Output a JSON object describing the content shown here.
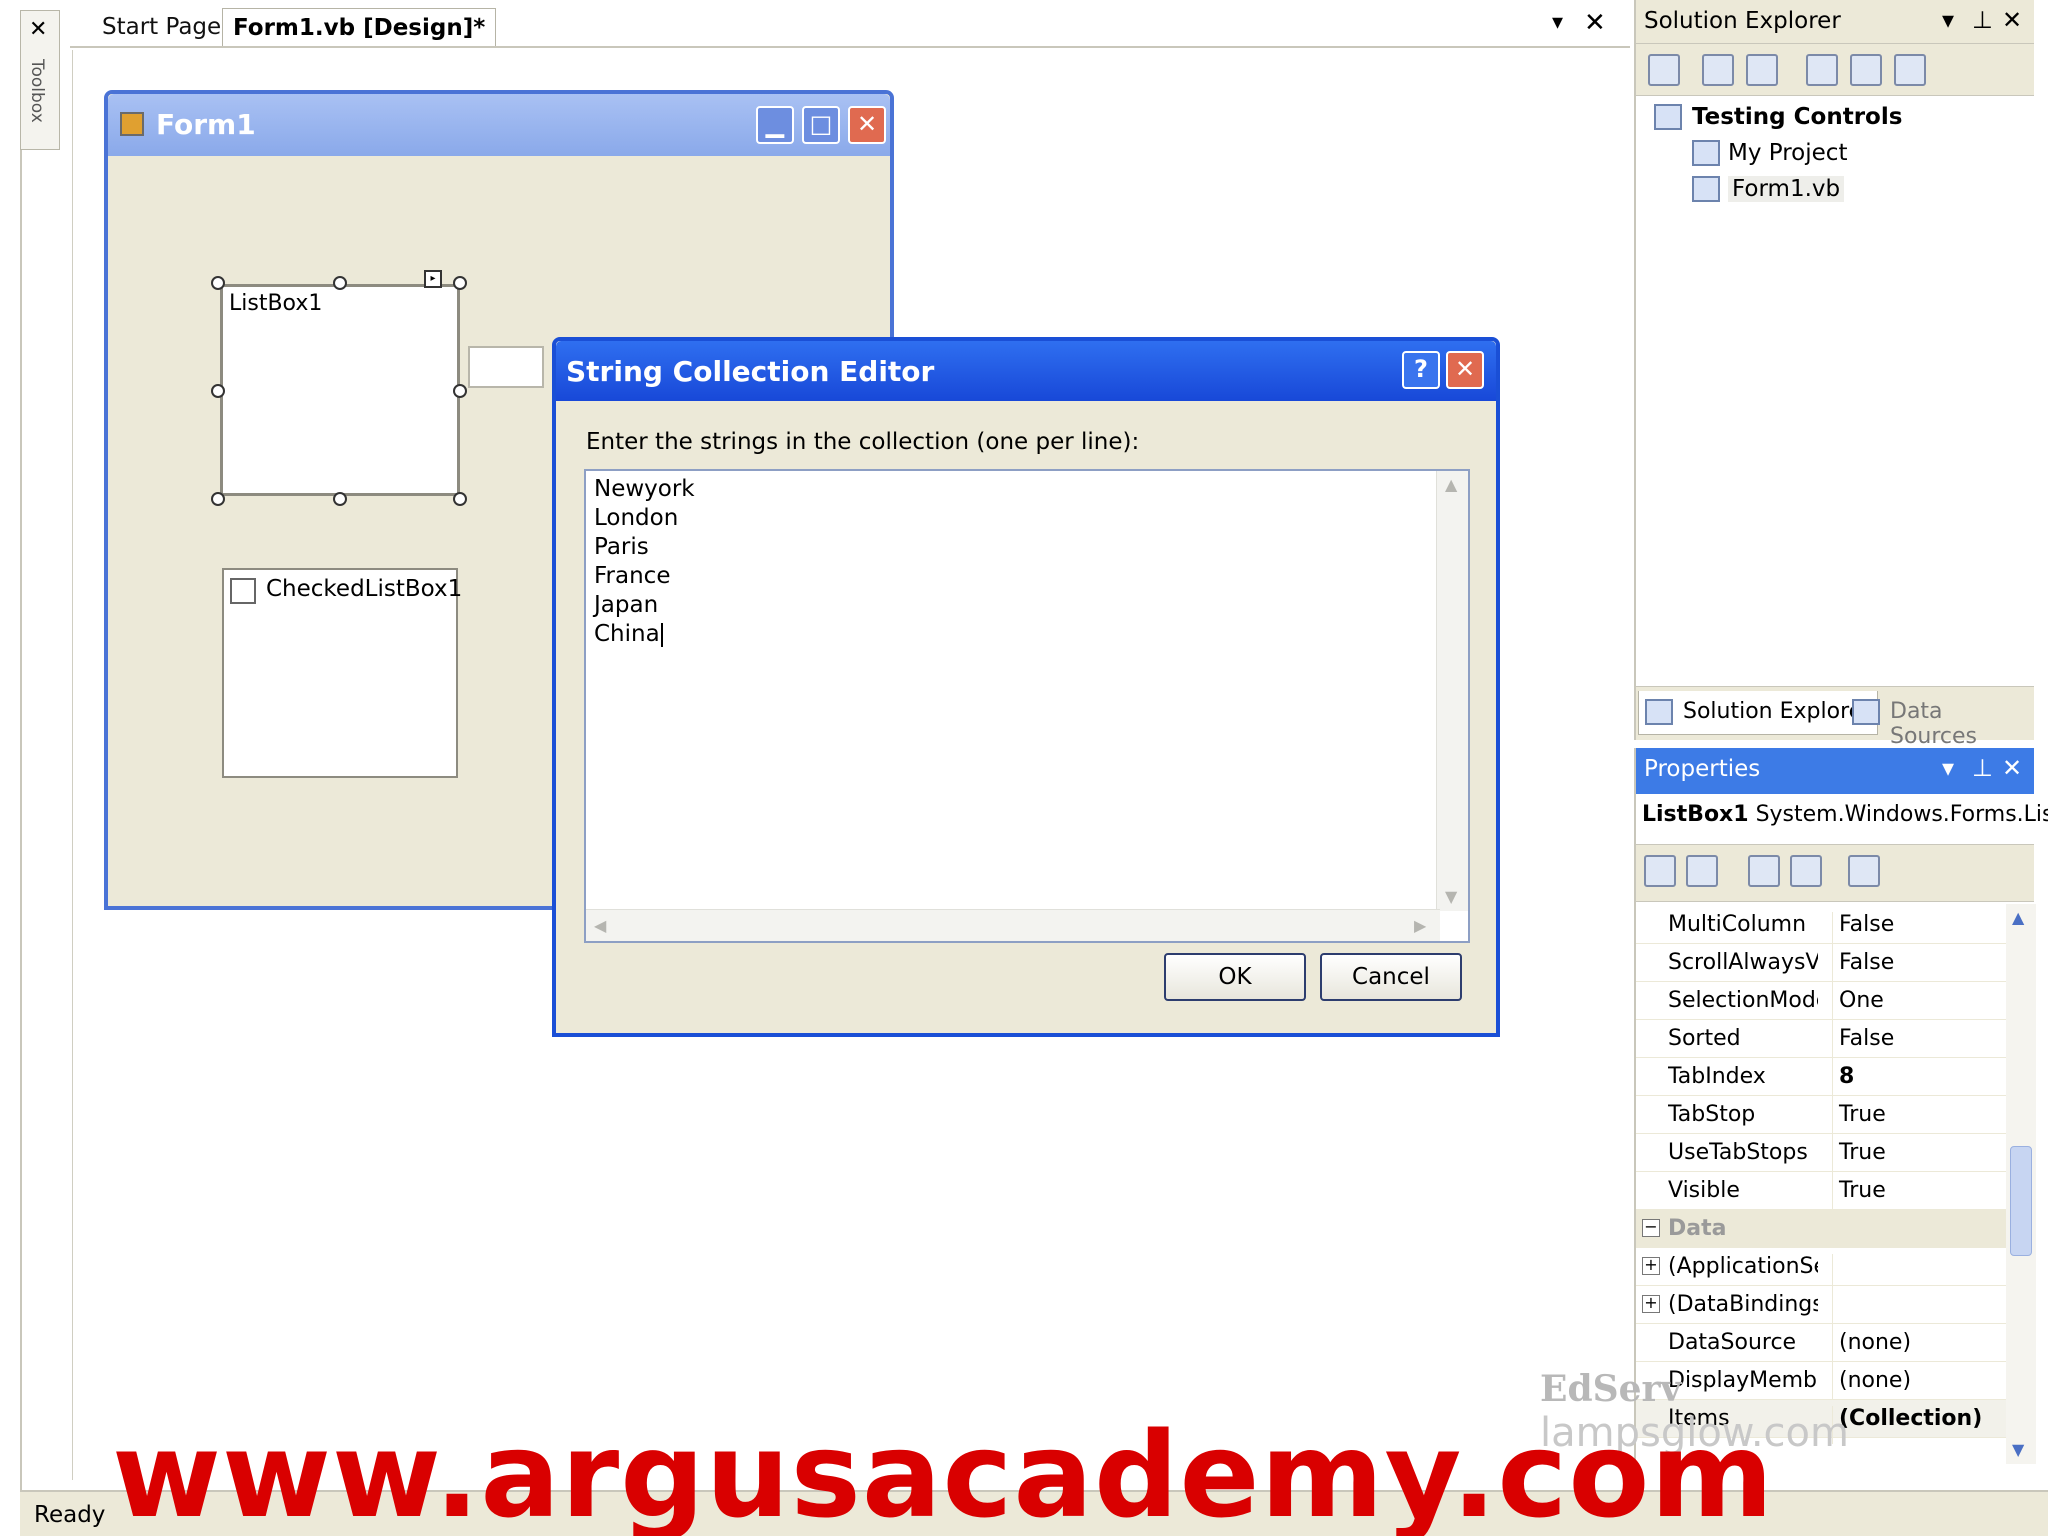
{
  "document_tabs": {
    "start_page": "Start Page",
    "active": "Form1.vb [Design]*"
  },
  "toolbox": {
    "label": "Toolbox"
  },
  "form1": {
    "title": "Form1",
    "listbox_label": "ListBox1",
    "checkedlistbox_label": "CheckedListBox1"
  },
  "string_collection_editor": {
    "title": "String Collection Editor",
    "help_glyph": "?",
    "prompt": "Enter the strings in the collection (one per line):",
    "lines": [
      "Newyork",
      "London",
      "Paris",
      "France",
      "Japan",
      "China"
    ],
    "ok_label": "OK",
    "cancel_label": "Cancel"
  },
  "solution_explorer": {
    "title": "Solution Explorer",
    "tree": {
      "project": "Testing Controls",
      "items": [
        "My Project",
        "Form1.vb"
      ]
    },
    "tabs": [
      "Solution Explorer",
      "Data Sources"
    ]
  },
  "properties": {
    "title": "Properties",
    "object_name": "ListBox1",
    "object_type": "System.Windows.Forms.Lis",
    "rows": [
      {
        "name": "MultiColumn",
        "value": "False"
      },
      {
        "name": "ScrollAlwaysVisit",
        "value": "False"
      },
      {
        "name": "SelectionMode",
        "value": "One"
      },
      {
        "name": "Sorted",
        "value": "False"
      },
      {
        "name": "TabIndex",
        "value": "8"
      },
      {
        "name": "TabStop",
        "value": "True"
      },
      {
        "name": "UseTabStops",
        "value": "True"
      },
      {
        "name": "Visible",
        "value": "True"
      }
    ],
    "category": "Data",
    "data_rows": [
      {
        "name": "(ApplicationSetti",
        "value": ""
      },
      {
        "name": "(DataBindings)",
        "value": ""
      },
      {
        "name": "DataSource",
        "value": "(none)"
      },
      {
        "name": "DisplayMember",
        "value": "(none)"
      },
      {
        "name": "Items",
        "value": "(Collection)"
      }
    ]
  },
  "status_bar": {
    "text": "Ready"
  },
  "watermarks": {
    "edserv": "EdServ",
    "lampsglow": "lampsglow.com",
    "argus": "www.argusacademy.com"
  },
  "colors": {
    "xp_blue": "#1a4fd6",
    "form_surface": "#ece9d8",
    "watermark_red": "#d90000"
  }
}
